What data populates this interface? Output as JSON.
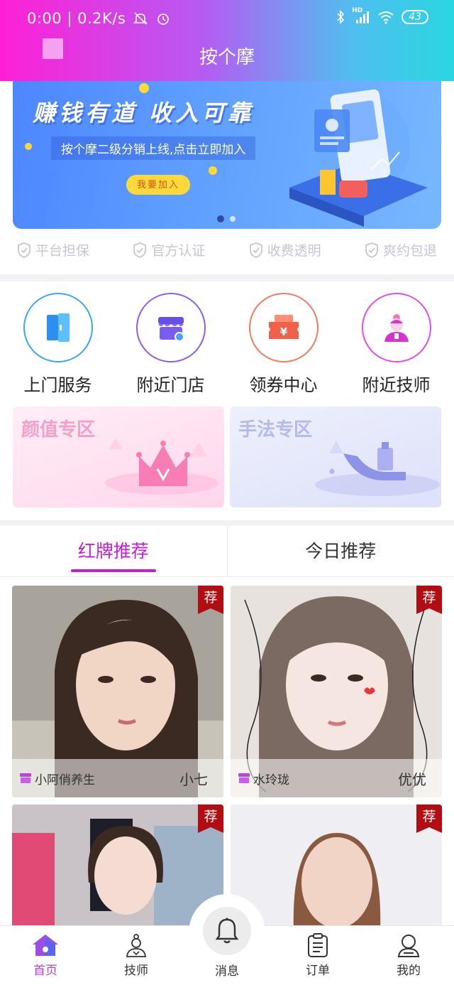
{
  "status_bar": {
    "time": "0:00",
    "speed": "0.2K/s",
    "battery": "43",
    "network": "HD"
  },
  "header": {
    "title": "按个摩"
  },
  "banner": {
    "headline": "赚钱有道  收入可靠",
    "subtitle": "按个摩二级分销上线,点击立即加入",
    "button": "我要加入",
    "slide_count": 2,
    "active_slide": 1
  },
  "guarantees": [
    {
      "label": "平台担保",
      "icon": "shield-check-icon"
    },
    {
      "label": "官方认证",
      "icon": "shield-check-icon"
    },
    {
      "label": "收费透明",
      "icon": "shield-check-icon"
    },
    {
      "label": "爽约包退",
      "icon": "shield-check-icon"
    }
  ],
  "categories": [
    {
      "label": "上门服务",
      "icon": "door-icon",
      "color": "#3aa8ef"
    },
    {
      "label": "附近门店",
      "icon": "store-icon",
      "color": "#8a5ef0"
    },
    {
      "label": "领券中心",
      "icon": "coupon-icon",
      "color": "#f57a5c"
    },
    {
      "label": "附近技师",
      "icon": "technician-icon",
      "color": "#e04fe4"
    }
  ],
  "zones": [
    {
      "title": "颜值专区",
      "icon": "crown-icon"
    },
    {
      "title": "手法专区",
      "icon": "hand-bottle-icon"
    }
  ],
  "tabs": [
    {
      "label": "红牌推荐",
      "active": true
    },
    {
      "label": "今日推荐",
      "active": false
    }
  ],
  "recommend_tag": "荐",
  "technicians": [
    {
      "shop": "小阿俏养生",
      "name": "小七"
    },
    {
      "shop": "水玲珑",
      "name": "优优"
    },
    {
      "shop": "",
      "name": ""
    },
    {
      "shop": "",
      "name": ""
    }
  ],
  "bottom_nav": [
    {
      "label": "首页",
      "icon": "home-icon",
      "active": true
    },
    {
      "label": "技师",
      "icon": "technician-nav-icon",
      "active": false
    },
    {
      "label": "消息",
      "icon": "bell-icon",
      "active": false
    },
    {
      "label": "订单",
      "icon": "order-icon",
      "active": false
    },
    {
      "label": "我的",
      "icon": "profile-icon",
      "active": false
    }
  ],
  "colors": {
    "accent": "#c21ed6",
    "header_start": "#ff1fd6",
    "header_end": "#2ad6e0",
    "tag_red": "#b10d13"
  }
}
